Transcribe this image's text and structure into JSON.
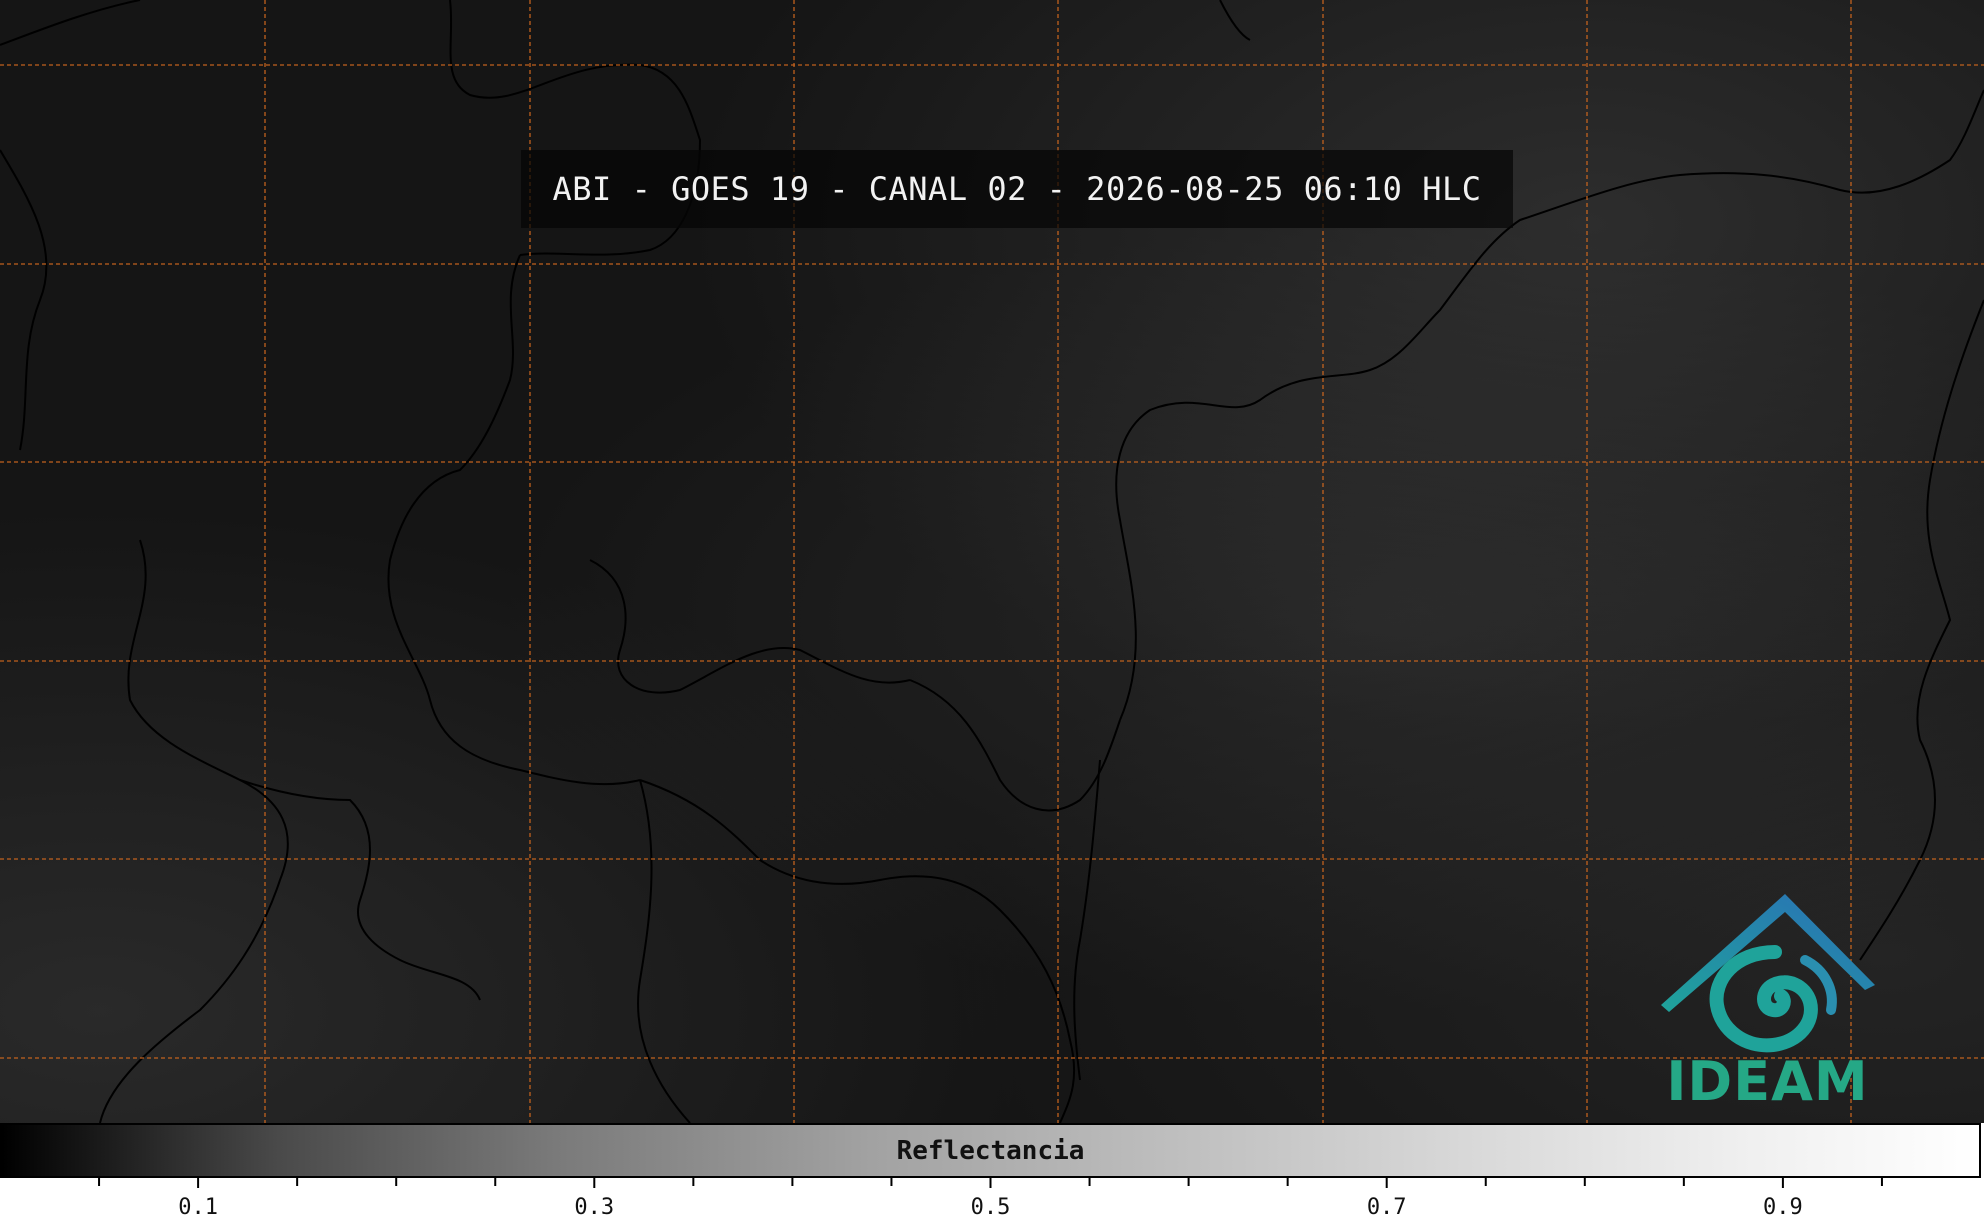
{
  "title": "ABI - GOES 19 - CANAL 02 - 2026-08-25 06:10 HLC",
  "logo": {
    "text": "IDEAM",
    "icon": "ideam-logo-icon",
    "colors": {
      "roof": "#2a7fb8",
      "swirl": "#1fa39a",
      "text": "#25a886"
    }
  },
  "colorbar": {
    "label": "Reflectancia",
    "min": 0.0,
    "max": 1.0,
    "tick_labels": [
      "0.1",
      "0.3",
      "0.5",
      "0.7",
      "0.9"
    ],
    "colormap": "grayscale"
  },
  "map": {
    "background_color": "#151515",
    "gridline_color": "#d2691e",
    "gridline_style": "dashed",
    "border_color": "#000000"
  }
}
